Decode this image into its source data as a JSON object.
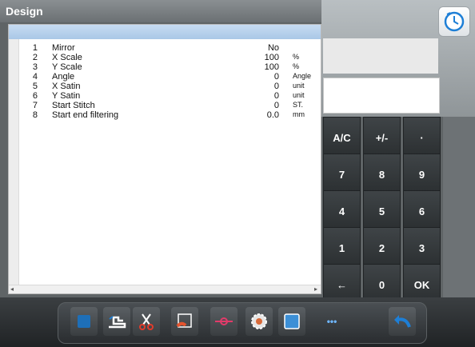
{
  "window": {
    "title": "Design"
  },
  "params": [
    {
      "num": "1",
      "name": "Mirror",
      "value": "No",
      "unit": ""
    },
    {
      "num": "2",
      "name": "X Scale",
      "value": "100",
      "unit": "%"
    },
    {
      "num": "3",
      "name": "Y Scale",
      "value": "100",
      "unit": "%"
    },
    {
      "num": "4",
      "name": "Angle",
      "value": "0",
      "unit": "Angle"
    },
    {
      "num": "5",
      "name": "X Satin",
      "value": "0",
      "unit": "unit"
    },
    {
      "num": "6",
      "name": "Y Satin",
      "value": "0",
      "unit": "unit"
    },
    {
      "num": "7",
      "name": "Start Stitch",
      "value": "0",
      "unit": "ST."
    },
    {
      "num": "8",
      "name": "Start end filtering",
      "value": "0.0",
      "unit": "mm"
    }
  ],
  "keypad": {
    "keys": [
      "A/C",
      "+/-",
      "·",
      "7",
      "8",
      "9",
      "4",
      "5",
      "6",
      "1",
      "2",
      "3",
      "←",
      "0",
      "OK"
    ]
  },
  "toolbar": {
    "icons": [
      "design-icon",
      "machine-icon",
      "scissors-icon",
      "frame-icon",
      "thread-icon",
      "settings-wheel-icon",
      "image-icon",
      "more-icon",
      "undo-icon"
    ],
    "more_label": "•••"
  },
  "colors": {
    "header": "#a9c7e6",
    "keypad": "#2a2e30",
    "accent": "#1e7fd6"
  }
}
